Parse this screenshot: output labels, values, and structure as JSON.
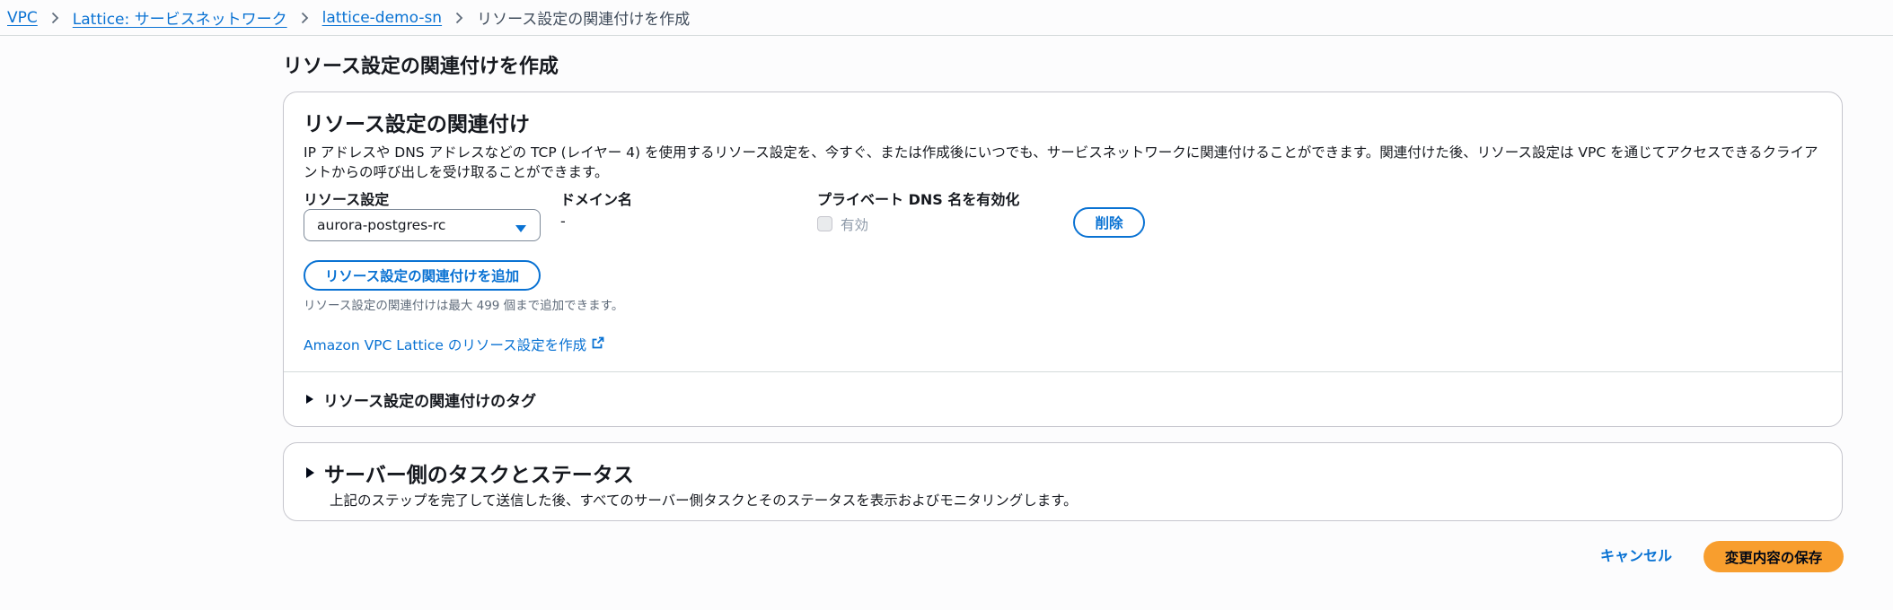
{
  "breadcrumb": {
    "items": [
      "VPC",
      "Lattice: サービスネットワーク",
      "lattice-demo-sn"
    ],
    "current": "リソース設定の関連付けを作成"
  },
  "page_title": "リソース設定の関連付けを作成",
  "association_panel": {
    "title": "リソース設定の関連付け",
    "description": "IP アドレスや DNS アドレスなどの TCP (レイヤー 4) を使用するリソース設定を、今すぐ、または作成後にいつでも、サービスネットワークに関連付けることができます。関連付けた後、リソース設定は VPC を通じてアクセスできるクライアントからの呼び出しを受け取ることができます。",
    "columns": {
      "resource_config": "リソース設定",
      "domain_name": "ドメイン名",
      "private_dns": "プライベート DNS 名を有効化"
    },
    "row": {
      "resource_config_value": "aurora-postgres-rc",
      "domain_name_value": "-",
      "private_dns_checkbox_label": "有効",
      "delete_label": "削除"
    },
    "add_button_label": "リソース設定の関連付けを追加",
    "hint": "リソース設定の関連付けは最大 499 個まで追加できます。",
    "external_link": "Amazon VPC Lattice のリソース設定を作成",
    "tags_expander": "リソース設定の関連付けのタグ"
  },
  "server_panel": {
    "title": "サーバー側のタスクとステータス",
    "description": "上記のステップを完了して送信した後、すべてのサーバー側タスクとそのステータスを表示およびモニタリングします。"
  },
  "actions": {
    "cancel": "キャンセル",
    "save": "変更内容の保存"
  },
  "colors": {
    "link": "#0972d3",
    "primary_button": "#f89e2e",
    "border": "#c6c6cd"
  }
}
